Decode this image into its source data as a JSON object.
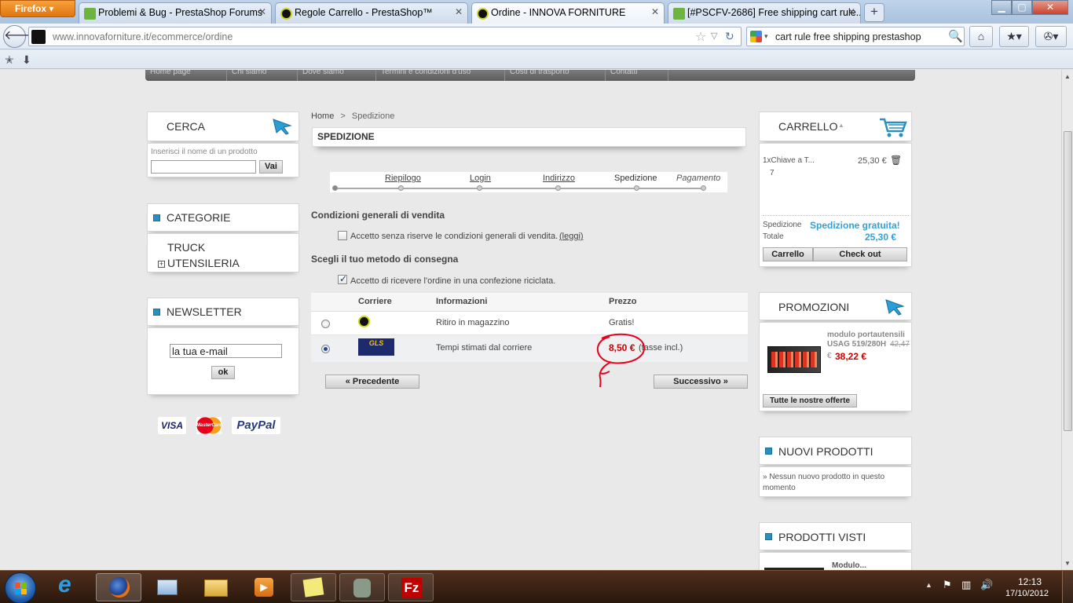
{
  "browser": {
    "menu_label": "Firefox",
    "tabs": [
      {
        "title": "Problemi & Bug - PrestaShop Forums",
        "favicon": "prestashop-icon"
      },
      {
        "title": "Regole Carrello - PrestaShop™",
        "favicon": "innova-icon"
      },
      {
        "title": "Ordine - INNOVA FORNITURE",
        "favicon": "innova-icon"
      },
      {
        "title": "[#PSCFV-2686] Free shipping cart rule...",
        "favicon": "prestashop-icon"
      }
    ],
    "url_domain": "www.innovaforniture.it",
    "url_path": "/ecommerce/ordine",
    "search_text": "cart rule free shipping prestashop"
  },
  "topnav": [
    "Home page",
    "Chi siamo",
    "Dove siamo",
    "Termini e condizioni d'uso",
    "Costi di trasporto",
    "Contatti"
  ],
  "left": {
    "search": {
      "title": "CERCA",
      "hint": "Inserisci il nome di un prodotto",
      "button": "Vai"
    },
    "categories": {
      "title": "CATEGORIE",
      "items": [
        "TRUCK",
        "UTENSILERIA"
      ],
      "expander": "+"
    },
    "newsletter": {
      "title": "NEWSLETTER",
      "email_value": "la tua e-mail",
      "button": "ok"
    },
    "payments": [
      "VISA",
      "MasterCard",
      "PayPal"
    ]
  },
  "main": {
    "breadcrumb": {
      "home": "Home",
      "sep": ">",
      "current": "Spedizione"
    },
    "title": "SPEDIZIONE",
    "steps": [
      "Riepilogo",
      "Login",
      "Indirizzo",
      "Spedizione",
      "Pagamento"
    ],
    "terms_heading": "Condizioni generali di vendita",
    "terms_label": "Accetto senza riserve le condizioni generali di vendita.",
    "terms_link": "(leggi)",
    "delivery_heading": "Scegli il tuo metodo di consegna",
    "recycle_label": "Accetto di ricevere l'ordine in una confezione riciclata.",
    "table_headers": {
      "carrier": "Corriere",
      "info": "Informazioni",
      "price": "Prezzo"
    },
    "carriers": [
      {
        "logo": "innova-icon",
        "info": "Ritiro in magazzino",
        "price": "Gratis!",
        "tax": "",
        "selected": false
      },
      {
        "logo": "GLS",
        "info": "Tempi stimati dal corriere",
        "price": "8,50 €",
        "tax": "(tasse incl.)",
        "selected": true
      }
    ],
    "prev_button": "« Precedente",
    "next_button": "Successivo »"
  },
  "right": {
    "cart": {
      "title": "CARRELLO",
      "item_name": "1xChiave a T...",
      "item_sub": "7",
      "item_price": "25,30 €",
      "shipping_label": "Spedizione",
      "shipping_value": "Spedizione gratuita!",
      "total_label": "Totale",
      "total_value": "25,30 €",
      "cart_button": "Carrello",
      "checkout_button": "Check out"
    },
    "promotions": {
      "title": "PROMOZIONI",
      "product_name": "modulo portautensili USAG 519/280H",
      "old_price": "42,47",
      "currency": "€",
      "new_price": "38,22 €",
      "button": "Tutte le nostre offerte"
    },
    "new_products": {
      "title": "NUOVI PRODOTTI",
      "text": "» Nessun nuovo prodotto in questo momento"
    },
    "viewed": {
      "title": "PRODOTTI VISTI",
      "item": "Modulo..."
    }
  },
  "taskbar": {
    "time": "12:13",
    "date": "17/10/2012",
    "apps": [
      "ie-icon",
      "firefox-icon",
      "explorer-icon",
      "folder-icon",
      "media-icon",
      "sticky-notes-icon",
      "evernote-icon",
      "filezilla-icon"
    ]
  },
  "colors": {
    "accent_blue": "#2a8fbf",
    "price_red": "#cc0000",
    "link_blue": "#35a0d6"
  }
}
